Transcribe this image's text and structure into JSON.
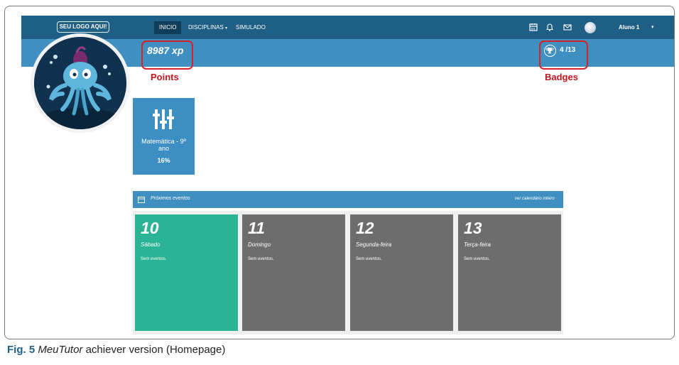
{
  "navbar": {
    "logo": "SEU LOGO AQUI!",
    "items": [
      {
        "label": "INICIO"
      },
      {
        "label": "DISCIPLINAS"
      },
      {
        "label": "SIMULADO"
      }
    ],
    "icons": [
      "calendar-icon",
      "bell-icon",
      "mail-icon"
    ],
    "user": "Aluno 1"
  },
  "stats": {
    "xp": "8987 xp",
    "badges": "4 /13"
  },
  "annotations": {
    "points": "Points",
    "badges": "Badges"
  },
  "discipline": {
    "name": "Matemática - 9º ano",
    "progress": "16%"
  },
  "events": {
    "title": "Próximos eventos",
    "link": "ver calendário inteiro",
    "days": [
      {
        "num": "10",
        "name": "Sábado",
        "events": "Sem eventos."
      },
      {
        "num": "11",
        "name": "Domingo",
        "events": "Sem eventos."
      },
      {
        "num": "12",
        "name": "Segunda-feira",
        "events": "Sem eventos."
      },
      {
        "num": "13",
        "name": "Terça-feira",
        "events": "Sem eventos."
      }
    ]
  },
  "caption": {
    "fig": "Fig. 5",
    "app": "MeuTutor",
    "rest": " achiever version (Homepage)"
  },
  "colors": {
    "navbar": "#1f5f86",
    "statsbar": "#3f8fc1",
    "today": "#2ab394",
    "day": "#6d6d6d",
    "highlight": "#d6222a"
  }
}
